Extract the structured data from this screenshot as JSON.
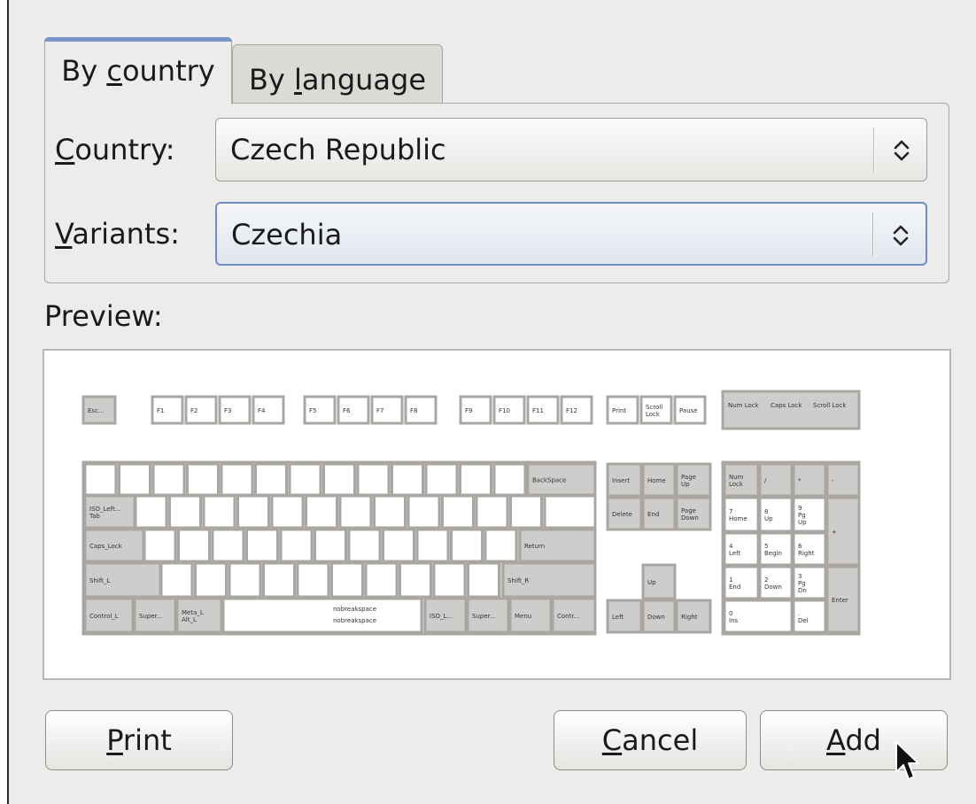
{
  "tabs": [
    {
      "pre": "By ",
      "mnemonic": "c",
      "post": "ountry",
      "active": true
    },
    {
      "pre": "By ",
      "mnemonic": "l",
      "post": "anguage",
      "active": false
    }
  ],
  "country": {
    "label_mnemonic": "C",
    "label_rest": "ountry:",
    "value": "Czech Republic"
  },
  "variants": {
    "label_mnemonic": "V",
    "label_rest": "ariants:",
    "value": "Czechia"
  },
  "preview_label": "Preview:",
  "buttons": {
    "print": {
      "mnemonic": "P",
      "rest": "rint"
    },
    "cancel": {
      "mnemonic": "C",
      "rest": "ancel"
    },
    "add": {
      "mnemonic": "A",
      "rest": "dd"
    }
  },
  "keyboard": {
    "function_row": [
      "Esc...",
      "F1",
      "F2",
      "F3",
      "F4",
      "F5",
      "F6",
      "F7",
      "F8",
      "F9",
      "F10",
      "F11",
      "F12",
      "Print",
      "Scroll Lock",
      "Pause"
    ],
    "lock_indicators": [
      "Num Lock",
      "Caps Lock",
      "Scroll Lock"
    ],
    "named_keys": [
      "BackSpace",
      "ISO_Left...",
      "Tab",
      "Caps_Lock",
      "Return",
      "Shift_L",
      "Shift_R",
      "Control_L",
      "Super...",
      "Meta_L",
      "Alt_L",
      "nobreakspace",
      "nobreakspace",
      "ISO_L...",
      "Super...",
      "Menu",
      "Contr..."
    ],
    "nav_keys": [
      "Insert",
      "Home",
      "Page Up",
      "Delete",
      "End",
      "Page Down",
      "Up",
      "Left",
      "Down",
      "Right"
    ],
    "numpad_keys": [
      "Num Lock",
      "/",
      "*",
      "-",
      "7 Home",
      "8 Up",
      "9 Pg Up",
      "+",
      "4 Left",
      "5 Begin",
      "6 Right",
      "1 End",
      "2 Down",
      "3 Pg Dn",
      "Enter",
      "0 Ins",
      ". Del"
    ]
  }
}
